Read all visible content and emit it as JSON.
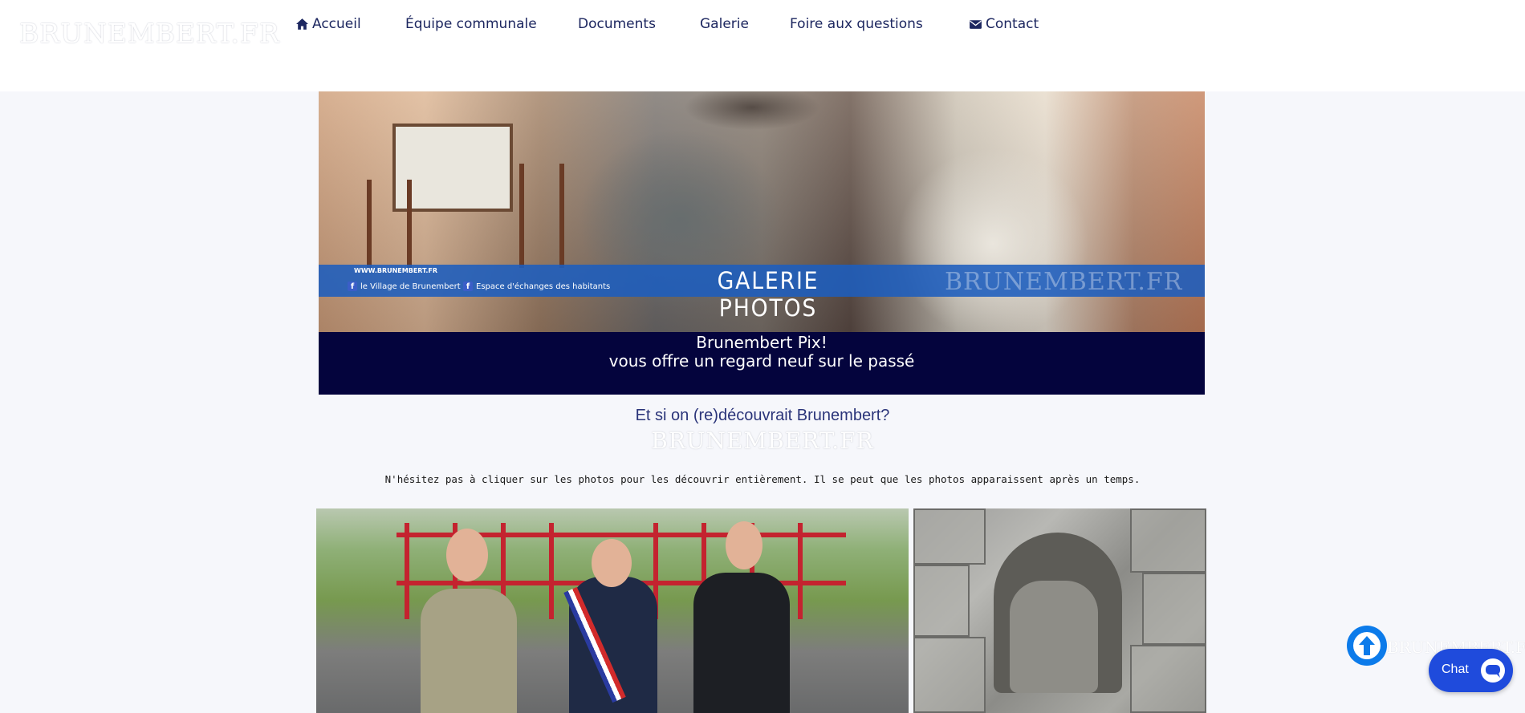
{
  "header": {
    "logo": "BRUNEMBERT.FR",
    "nav": [
      {
        "label": "Accueil",
        "icon": "home-icon"
      },
      {
        "label": "Équipe communale"
      },
      {
        "label": "Documents"
      },
      {
        "label": "Galerie"
      },
      {
        "label": "Foire aux questions"
      },
      {
        "label": "Contact",
        "icon": "envelope-icon"
      }
    ]
  },
  "banner": {
    "url": "WWW.BRUNEMBERT.FR",
    "fb_links": [
      "le Village de Brunembert",
      "Espace d'échanges des habitants"
    ],
    "title": "GALERIE PHOTOS",
    "watermark": "BRUNEMBERT.FR"
  },
  "intro": {
    "line1": "Brunembert Pix!",
    "line2": "vous offre un regard neuf sur le passé"
  },
  "section": {
    "title": "Et si on (re)découvrait Brunembert?",
    "watermark": "BRUNEMBERT.FR",
    "hint": "N'hésitez pas à cliquer sur les photos pour les découvrir entièrement. Il se peut que les photos apparaissent après un temps."
  },
  "widgets": {
    "side_watermark": "BRUNEMBERT.FR",
    "chat_label": "Chat"
  },
  "colors": {
    "navy": "#04043d",
    "accent_blue": "#1f4bdc",
    "scroll_blue": "#0c7bea",
    "strip_blue": "#1c5dbe",
    "title": "#2b357a"
  }
}
